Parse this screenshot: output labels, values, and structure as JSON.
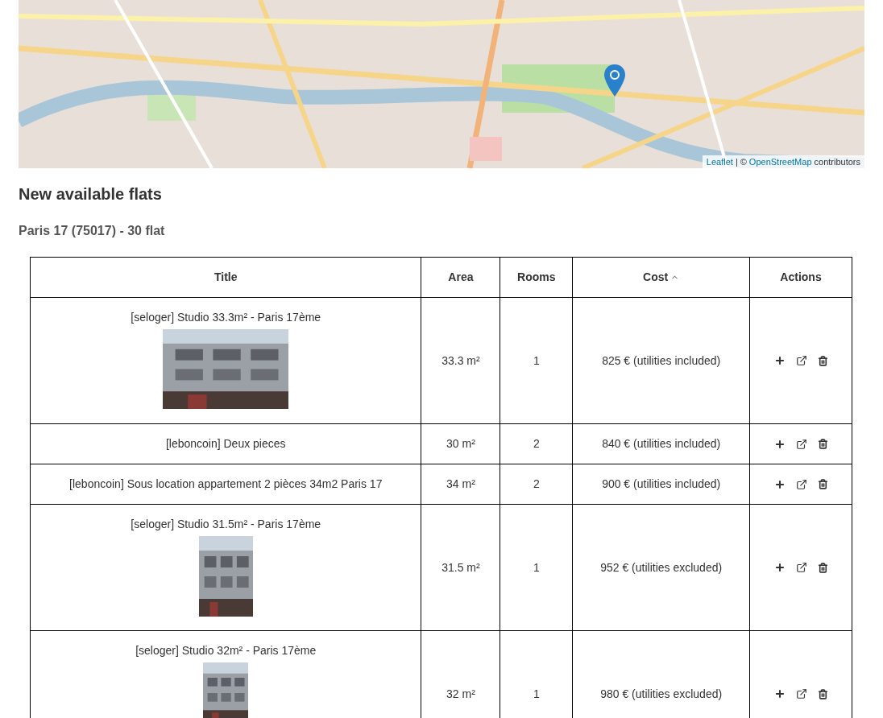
{
  "map": {
    "attribution": {
      "link_1": "Leaflet",
      "separator": "|",
      "copyright": "©",
      "link_2": "OpenStreetMap",
      "suffix": "contributors"
    }
  },
  "heading": "New available flats",
  "subheading": "Paris 17 (75017) - 30 flat",
  "table": {
    "columns": [
      {
        "label": "Title",
        "sorted": false
      },
      {
        "label": "Area",
        "sorted": false
      },
      {
        "label": "Rooms",
        "sorted": false
      },
      {
        "label": "Cost",
        "sorted": true
      },
      {
        "label": "Actions",
        "sorted": false
      }
    ],
    "rows": [
      {
        "title": "[seloger] Studio 33.3m² - Paris 17ème",
        "area": "33.3 m²",
        "rooms": "1",
        "cost": "825 € (utilities included)"
      },
      {
        "title": "[leboncoin] Deux pieces",
        "area": "30 m²",
        "rooms": "2",
        "cost": "840 € (utilities included)"
      },
      {
        "title": "[leboncoin] Sous location appartement 2 pièces 34m2 Paris 17",
        "area": "34 m²",
        "rooms": "2",
        "cost": "900 € (utilities included)"
      },
      {
        "title": "[seloger] Studio 31.5m² - Paris 17ème",
        "area": "31.5 m²",
        "rooms": "1",
        "cost": "952 € (utilities excluded)"
      },
      {
        "title": "[seloger] Studio 32m² - Paris 17ème",
        "area": "32 m²",
        "rooms": "1",
        "cost": "980 € (utilities excluded)"
      }
    ]
  }
}
